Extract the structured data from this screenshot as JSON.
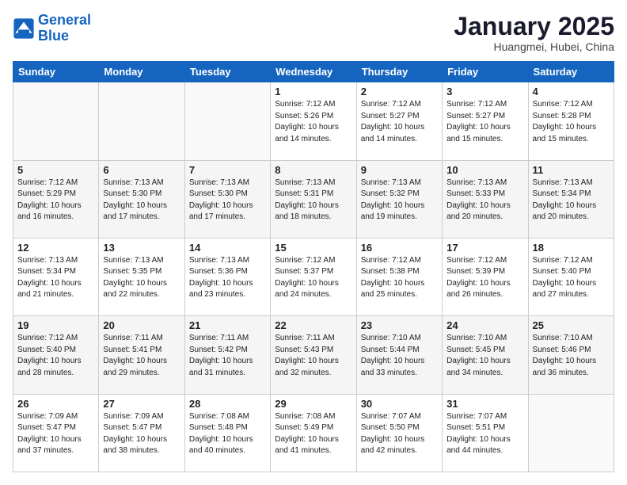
{
  "logo": {
    "line1": "General",
    "line2": "Blue"
  },
  "title": "January 2025",
  "location": "Huangmei, Hubei, China",
  "days_of_week": [
    "Sunday",
    "Monday",
    "Tuesday",
    "Wednesday",
    "Thursday",
    "Friday",
    "Saturday"
  ],
  "weeks": [
    [
      {
        "num": "",
        "info": ""
      },
      {
        "num": "",
        "info": ""
      },
      {
        "num": "",
        "info": ""
      },
      {
        "num": "1",
        "info": "Sunrise: 7:12 AM\nSunset: 5:26 PM\nDaylight: 10 hours\nand 14 minutes."
      },
      {
        "num": "2",
        "info": "Sunrise: 7:12 AM\nSunset: 5:27 PM\nDaylight: 10 hours\nand 14 minutes."
      },
      {
        "num": "3",
        "info": "Sunrise: 7:12 AM\nSunset: 5:27 PM\nDaylight: 10 hours\nand 15 minutes."
      },
      {
        "num": "4",
        "info": "Sunrise: 7:12 AM\nSunset: 5:28 PM\nDaylight: 10 hours\nand 15 minutes."
      }
    ],
    [
      {
        "num": "5",
        "info": "Sunrise: 7:12 AM\nSunset: 5:29 PM\nDaylight: 10 hours\nand 16 minutes."
      },
      {
        "num": "6",
        "info": "Sunrise: 7:13 AM\nSunset: 5:30 PM\nDaylight: 10 hours\nand 17 minutes."
      },
      {
        "num": "7",
        "info": "Sunrise: 7:13 AM\nSunset: 5:30 PM\nDaylight: 10 hours\nand 17 minutes."
      },
      {
        "num": "8",
        "info": "Sunrise: 7:13 AM\nSunset: 5:31 PM\nDaylight: 10 hours\nand 18 minutes."
      },
      {
        "num": "9",
        "info": "Sunrise: 7:13 AM\nSunset: 5:32 PM\nDaylight: 10 hours\nand 19 minutes."
      },
      {
        "num": "10",
        "info": "Sunrise: 7:13 AM\nSunset: 5:33 PM\nDaylight: 10 hours\nand 20 minutes."
      },
      {
        "num": "11",
        "info": "Sunrise: 7:13 AM\nSunset: 5:34 PM\nDaylight: 10 hours\nand 20 minutes."
      }
    ],
    [
      {
        "num": "12",
        "info": "Sunrise: 7:13 AM\nSunset: 5:34 PM\nDaylight: 10 hours\nand 21 minutes."
      },
      {
        "num": "13",
        "info": "Sunrise: 7:13 AM\nSunset: 5:35 PM\nDaylight: 10 hours\nand 22 minutes."
      },
      {
        "num": "14",
        "info": "Sunrise: 7:13 AM\nSunset: 5:36 PM\nDaylight: 10 hours\nand 23 minutes."
      },
      {
        "num": "15",
        "info": "Sunrise: 7:12 AM\nSunset: 5:37 PM\nDaylight: 10 hours\nand 24 minutes."
      },
      {
        "num": "16",
        "info": "Sunrise: 7:12 AM\nSunset: 5:38 PM\nDaylight: 10 hours\nand 25 minutes."
      },
      {
        "num": "17",
        "info": "Sunrise: 7:12 AM\nSunset: 5:39 PM\nDaylight: 10 hours\nand 26 minutes."
      },
      {
        "num": "18",
        "info": "Sunrise: 7:12 AM\nSunset: 5:40 PM\nDaylight: 10 hours\nand 27 minutes."
      }
    ],
    [
      {
        "num": "19",
        "info": "Sunrise: 7:12 AM\nSunset: 5:40 PM\nDaylight: 10 hours\nand 28 minutes."
      },
      {
        "num": "20",
        "info": "Sunrise: 7:11 AM\nSunset: 5:41 PM\nDaylight: 10 hours\nand 29 minutes."
      },
      {
        "num": "21",
        "info": "Sunrise: 7:11 AM\nSunset: 5:42 PM\nDaylight: 10 hours\nand 31 minutes."
      },
      {
        "num": "22",
        "info": "Sunrise: 7:11 AM\nSunset: 5:43 PM\nDaylight: 10 hours\nand 32 minutes."
      },
      {
        "num": "23",
        "info": "Sunrise: 7:10 AM\nSunset: 5:44 PM\nDaylight: 10 hours\nand 33 minutes."
      },
      {
        "num": "24",
        "info": "Sunrise: 7:10 AM\nSunset: 5:45 PM\nDaylight: 10 hours\nand 34 minutes."
      },
      {
        "num": "25",
        "info": "Sunrise: 7:10 AM\nSunset: 5:46 PM\nDaylight: 10 hours\nand 36 minutes."
      }
    ],
    [
      {
        "num": "26",
        "info": "Sunrise: 7:09 AM\nSunset: 5:47 PM\nDaylight: 10 hours\nand 37 minutes."
      },
      {
        "num": "27",
        "info": "Sunrise: 7:09 AM\nSunset: 5:47 PM\nDaylight: 10 hours\nand 38 minutes."
      },
      {
        "num": "28",
        "info": "Sunrise: 7:08 AM\nSunset: 5:48 PM\nDaylight: 10 hours\nand 40 minutes."
      },
      {
        "num": "29",
        "info": "Sunrise: 7:08 AM\nSunset: 5:49 PM\nDaylight: 10 hours\nand 41 minutes."
      },
      {
        "num": "30",
        "info": "Sunrise: 7:07 AM\nSunset: 5:50 PM\nDaylight: 10 hours\nand 42 minutes."
      },
      {
        "num": "31",
        "info": "Sunrise: 7:07 AM\nSunset: 5:51 PM\nDaylight: 10 hours\nand 44 minutes."
      },
      {
        "num": "",
        "info": ""
      }
    ]
  ]
}
